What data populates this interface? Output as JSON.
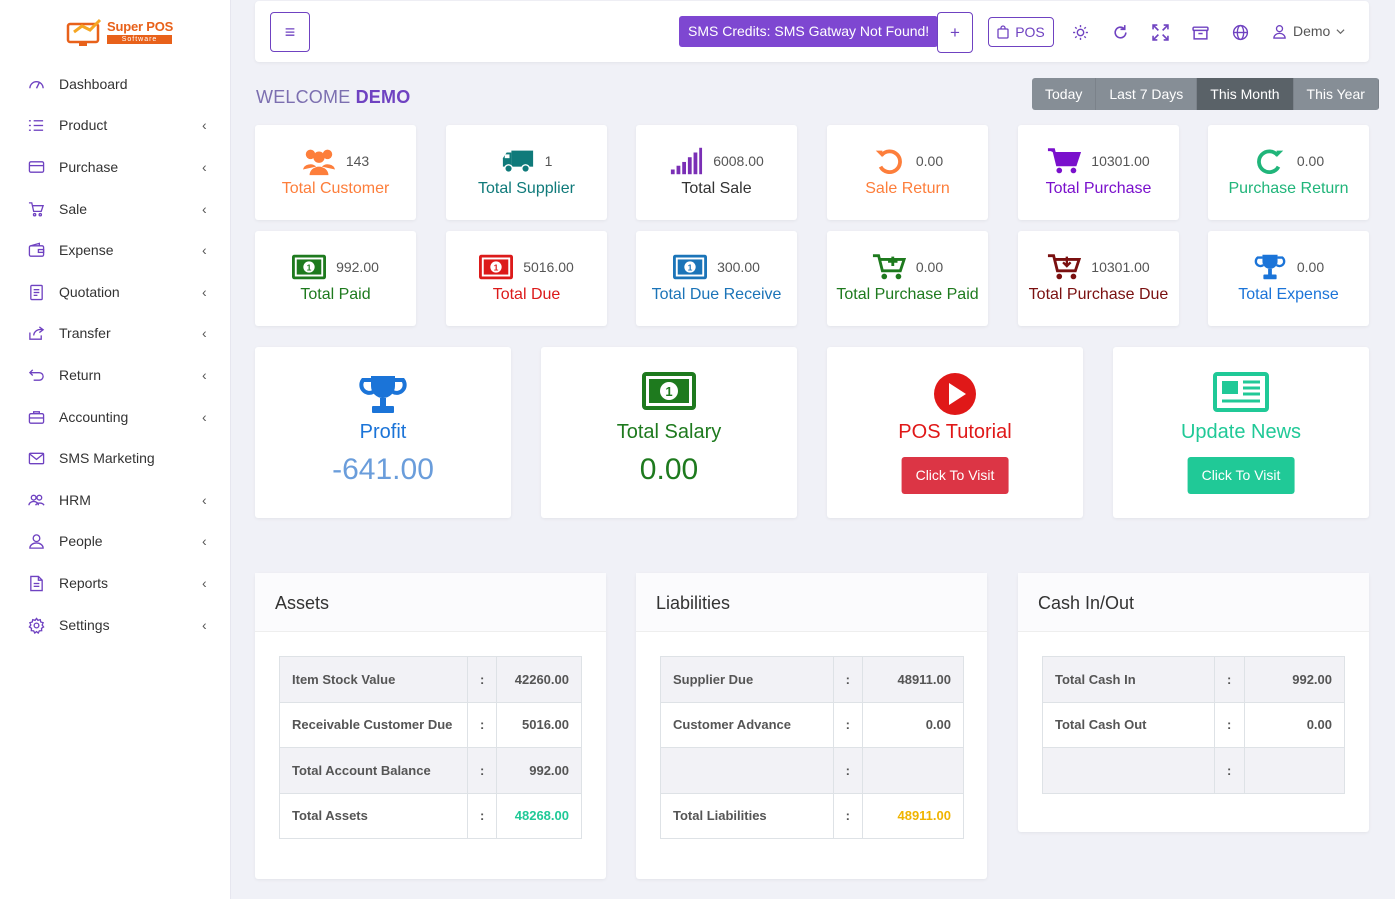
{
  "logo": {
    "brand": "Super POS",
    "tagline": "Software"
  },
  "sidebar": {
    "items": [
      {
        "label": "Dashboard",
        "icon": "dashboard-icon",
        "chevron": false
      },
      {
        "label": "Product",
        "icon": "list-icon",
        "chevron": true
      },
      {
        "label": "Purchase",
        "icon": "credit-card-icon",
        "chevron": true
      },
      {
        "label": "Sale",
        "icon": "cart-icon",
        "chevron": true
      },
      {
        "label": "Expense",
        "icon": "wallet-icon",
        "chevron": true
      },
      {
        "label": "Quotation",
        "icon": "document-icon",
        "chevron": true
      },
      {
        "label": "Transfer",
        "icon": "share-icon",
        "chevron": true
      },
      {
        "label": "Return",
        "icon": "return-icon",
        "chevron": true
      },
      {
        "label": "Accounting",
        "icon": "briefcase-icon",
        "chevron": true
      },
      {
        "label": "SMS Marketing",
        "icon": "envelope-icon",
        "chevron": false
      },
      {
        "label": "HRM",
        "icon": "users-icon",
        "chevron": true
      },
      {
        "label": "People",
        "icon": "user-icon",
        "chevron": true
      },
      {
        "label": "Reports",
        "icon": "file-icon",
        "chevron": true
      },
      {
        "label": "Settings",
        "icon": "gear-icon",
        "chevron": true
      }
    ],
    "chevron_glyph": "‹"
  },
  "topbar": {
    "menu_glyph": "≡",
    "sms_text": "SMS Credits: SMS Gatway Not Found!",
    "plus_glyph": "+",
    "pos_label": "POS",
    "user_name": "Demo"
  },
  "welcome": {
    "prefix": "WELCOME ",
    "name": "DEMO"
  },
  "date_ranges": [
    "Today",
    "Last 7 Days",
    "This Month",
    "This Year"
  ],
  "date_range_active": "This Month",
  "stats": [
    {
      "value": "143",
      "label": "Total Customer",
      "color": "#fd7e3b",
      "icon": "users-group-icon"
    },
    {
      "value": "1",
      "label": "Total Supplier",
      "color": "#0f7a7a",
      "icon": "truck-icon"
    },
    {
      "value": "6008.00",
      "label": "Total Sale",
      "color": "#333333",
      "icon": "signal-bars-icon"
    },
    {
      "value": "0.00",
      "label": "Sale Return",
      "color": "#fd7e3b",
      "icon": "undo-icon"
    },
    {
      "value": "10301.00",
      "label": "Total Purchase",
      "color": "#7a10cc",
      "icon": "cart-icon"
    },
    {
      "value": "0.00",
      "label": "Purchase Return",
      "color": "#20b57a",
      "icon": "redo-icon"
    },
    {
      "value": "992.00",
      "label": "Total Paid",
      "color": "#1e7a1e",
      "icon": "money-icon"
    },
    {
      "value": "5016.00",
      "label": "Total Due",
      "color": "#dc1a1a",
      "icon": "money-icon"
    },
    {
      "value": "300.00",
      "label": "Total Due Receive",
      "color": "#1b74b8",
      "icon": "money-icon"
    },
    {
      "value": "0.00",
      "label": "Total Purchase Paid",
      "color": "#1e7a1e",
      "icon": "cart-plus-icon"
    },
    {
      "value": "10301.00",
      "label": "Total Purchase Due",
      "color": "#7a1010",
      "icon": "cart-down-icon"
    },
    {
      "value": "0.00",
      "label": "Total Expense",
      "color": "#1b74d8",
      "icon": "trophy-icon"
    }
  ],
  "big_cards": {
    "profit": {
      "title": "Profit",
      "value": "-641.00",
      "color": "#1b74d8"
    },
    "salary": {
      "title": "Total Salary",
      "value": "0.00",
      "color": "#1e7a1e"
    },
    "tutorial": {
      "title": "POS Tutorial",
      "button": "Click To Visit",
      "color": "#e01818",
      "button_color": "#dc3545"
    },
    "news": {
      "title": "Update News",
      "button": "Click To Visit",
      "color": "#20c997",
      "button_color": "#20c997"
    }
  },
  "panels": {
    "assets": {
      "title": "Assets",
      "rows": [
        {
          "label": "Item Stock Value",
          "sep": ":",
          "value": "42260.00"
        },
        {
          "label": "Receivable Customer Due",
          "sep": ":",
          "value": "5016.00"
        },
        {
          "label": "Total Account Balance",
          "sep": ":",
          "value": "992.00"
        },
        {
          "label": "Total Assets",
          "sep": ":",
          "value": "48268.00",
          "value_color": "#20c997"
        }
      ]
    },
    "liabilities": {
      "title": "Liabilities",
      "rows": [
        {
          "label": "Supplier Due",
          "sep": ":",
          "value": "48911.00"
        },
        {
          "label": "Customer Advance",
          "sep": ":",
          "value": "0.00"
        },
        {
          "label": "",
          "sep": ":",
          "value": ""
        },
        {
          "label": "Total Liabilities",
          "sep": ":",
          "value": "48911.00",
          "value_color": "#f0b400"
        }
      ]
    },
    "cash": {
      "title": "Cash In/Out",
      "rows": [
        {
          "label": "Total Cash In",
          "sep": ":",
          "value": "992.00"
        },
        {
          "label": "Total Cash Out",
          "sep": ":",
          "value": "0.00"
        },
        {
          "label": "",
          "sep": ":",
          "value": ""
        }
      ]
    }
  }
}
